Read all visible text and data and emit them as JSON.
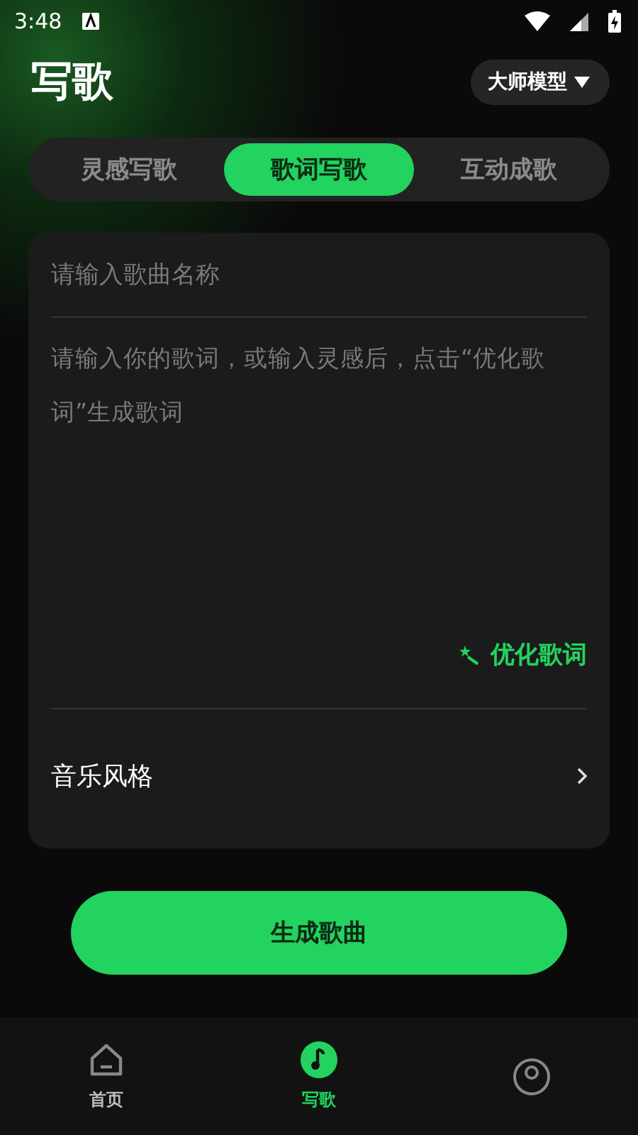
{
  "status_bar": {
    "time": "3:48"
  },
  "header": {
    "title": "写歌",
    "model_button": "大师模型"
  },
  "tabs": [
    {
      "label": "灵感写歌",
      "selected": false
    },
    {
      "label": "歌词写歌",
      "selected": true
    },
    {
      "label": "互动成歌",
      "selected": false
    }
  ],
  "form": {
    "song_name": {
      "placeholder": "请输入歌曲名称"
    },
    "lyrics": {
      "placeholder": "请输入你的歌词，或输入灵感后，点击“优化歌词”生成歌词"
    },
    "optimize_button": "优化歌词",
    "style_row": {
      "label": "音乐风格"
    }
  },
  "generate_button": "生成歌曲",
  "bottom_nav": [
    {
      "kind": "home",
      "label": "首页",
      "selected": false
    },
    {
      "kind": "music",
      "label": "写歌",
      "selected": true
    },
    {
      "kind": "profile",
      "selected": false
    }
  ]
}
